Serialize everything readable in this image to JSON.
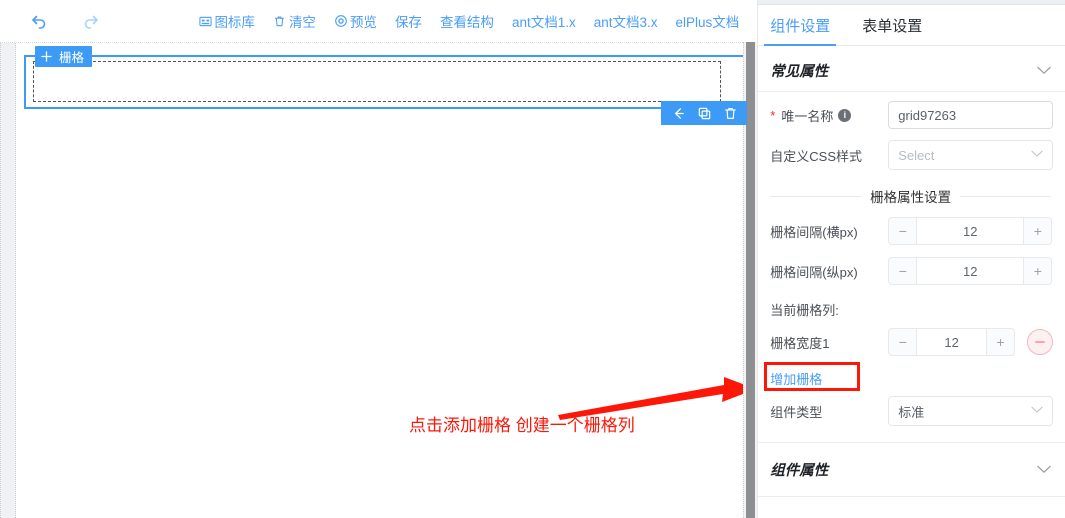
{
  "toolbar": {
    "undo_icon": "undo-arrow-icon",
    "redo_icon": "redo-arrow-icon",
    "items": [
      {
        "label": "图标库",
        "icon": "icon-library-icon"
      },
      {
        "label": "清空",
        "icon": "trash-icon"
      },
      {
        "label": "预览",
        "icon": "eye-preview-icon"
      },
      {
        "label": "保存",
        "icon": ""
      },
      {
        "label": "查看结构",
        "icon": ""
      },
      {
        "label": "ant文档1.x",
        "icon": ""
      },
      {
        "label": "ant文档3.x",
        "icon": ""
      },
      {
        "label": "elPlus文档",
        "icon": ""
      }
    ],
    "link_color": "#4a9df8"
  },
  "canvas": {
    "component": {
      "badge_label": "栅格",
      "move_icon": "move-cross-icon",
      "actions": [
        {
          "name": "back-arrow-icon",
          "glyph": "←"
        },
        {
          "name": "copy-icon",
          "glyph": "❐"
        },
        {
          "name": "delete-icon",
          "glyph": "🗑"
        }
      ],
      "selected_border_color": "#3d9bf5"
    },
    "annotation": {
      "text": "点击添加栅格 创建一个栅格列",
      "color": "#fd1708"
    }
  },
  "panel": {
    "tabs": [
      {
        "label": "组件设置",
        "active": true
      },
      {
        "label": "表单设置",
        "active": false
      }
    ],
    "sections": {
      "common": {
        "title": "常见属性",
        "collapse_icon": "chevron-down-icon",
        "fields": {
          "unique_name": {
            "label": "唯一名称",
            "required_mark": "*",
            "info_icon": "info-circle-icon",
            "value": "grid97263"
          },
          "custom_css": {
            "label": "自定义CSS样式",
            "placeholder": "Select",
            "chevron": "chevron-down-icon"
          }
        }
      },
      "grid_props": {
        "divider_title": "栅格属性设置",
        "gap_h": {
          "label": "栅格间隔(横px)",
          "value": "12",
          "minus": "−",
          "plus": "+"
        },
        "gap_v": {
          "label": "栅格间隔(纵px)",
          "value": "12",
          "minus": "−",
          "plus": "+"
        },
        "current_cols_label": "当前栅格列:",
        "col_width": {
          "label": "栅格宽度1",
          "value": "12",
          "minus": "−",
          "plus": "+",
          "remove_icon": "remove-circle-icon"
        },
        "add_link": "增加栅格",
        "comp_type": {
          "label": "组件类型",
          "value": "标准",
          "chevron": "chevron-down-icon"
        }
      },
      "component_props": {
        "title": "组件属性",
        "collapse_icon": "chevron-down-icon"
      }
    }
  }
}
